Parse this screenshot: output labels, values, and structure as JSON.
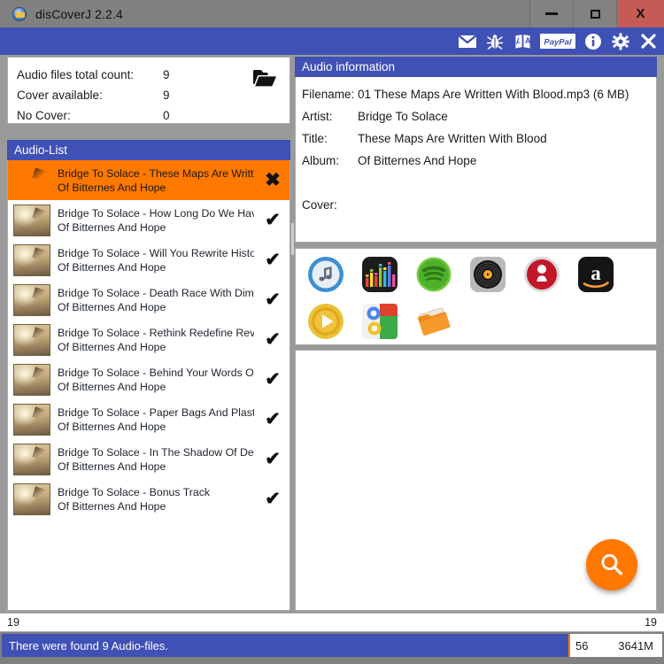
{
  "window": {
    "title": "disCoverJ 2.2.4",
    "app_icon": "disc-icon",
    "minimize_label": "",
    "maximize_label": "",
    "close_label": "X"
  },
  "toolbar": {
    "items": [
      {
        "name": "mail-icon",
        "tooltip": "Mail"
      },
      {
        "name": "bug-icon",
        "tooltip": "Report bug"
      },
      {
        "name": "translate-icon",
        "tooltip": "Translate"
      },
      {
        "name": "paypal-icon",
        "tooltip": "PayPal",
        "label": "PayPal"
      },
      {
        "name": "info-icon",
        "tooltip": "Info"
      },
      {
        "name": "gear-icon",
        "tooltip": "Settings"
      },
      {
        "name": "close-icon",
        "tooltip": "Close"
      }
    ]
  },
  "stats": {
    "rows": [
      {
        "label": "Audio files total count:",
        "value": "9"
      },
      {
        "label": "Cover available:",
        "value": "9"
      },
      {
        "label": "No Cover:",
        "value": "0"
      }
    ],
    "open_folder_icon": "open-folder-icon"
  },
  "audio_list": {
    "header": "Audio-List",
    "items": [
      {
        "title": "Bridge To Solace - These Maps Are Writte...",
        "subtitle": "Of Bitternes And Hope",
        "mark": "✖",
        "selected": true,
        "thumb": false
      },
      {
        "title": "Bridge To Solace - How Long Do We Have ...",
        "subtitle": "Of Bitternes And Hope",
        "mark": "✔",
        "selected": false,
        "thumb": true
      },
      {
        "title": "Bridge To Solace - Will You Rewrite Histor...",
        "subtitle": "Of Bitternes And Hope",
        "mark": "✔",
        "selected": false,
        "thumb": true
      },
      {
        "title": "Bridge To Solace - Death Race With Dimen...",
        "subtitle": "Of Bitternes And Hope",
        "mark": "✔",
        "selected": false,
        "thumb": true
      },
      {
        "title": "Bridge To Solace - Rethink Redefine Revolt",
        "subtitle": "Of Bitternes And Hope",
        "mark": "✔",
        "selected": false,
        "thumb": true
      },
      {
        "title": "Bridge To Solace - Behind Your Words Of ...",
        "subtitle": "Of Bitternes And Hope",
        "mark": "✔",
        "selected": false,
        "thumb": true
      },
      {
        "title": "Bridge To Solace - Paper Bags And Plastic ...",
        "subtitle": "Of Bitternes And Hope",
        "mark": "✔",
        "selected": false,
        "thumb": true
      },
      {
        "title": "Bridge To Solace - In The Shadow Of Death",
        "subtitle": "Of Bitternes And Hope",
        "mark": "✔",
        "selected": false,
        "thumb": true
      },
      {
        "title": "Bridge To Solace - Bonus Track",
        "subtitle": "Of Bitternes And Hope",
        "mark": "✔",
        "selected": false,
        "thumb": true
      }
    ]
  },
  "audio_information": {
    "header": "Audio information",
    "fields": [
      {
        "label": "Filename:",
        "value": "01 These Maps Are Written With Blood.mp3 (6 MB)"
      },
      {
        "label": "Artist:",
        "value": "Bridge To Solace"
      },
      {
        "label": "Title:",
        "value": "These Maps Are Written With Blood"
      },
      {
        "label": "Album:",
        "value": "Of Bitternes And Hope"
      }
    ],
    "cover_label": "Cover:",
    "cover_value": ""
  },
  "services": {
    "items": [
      {
        "name": "itunes-icon",
        "label": "iTunes"
      },
      {
        "name": "deezer-icon",
        "label": "Deezer"
      },
      {
        "name": "spotify-icon",
        "label": "Spotify"
      },
      {
        "name": "discogs-icon",
        "label": "Discogs"
      },
      {
        "name": "gracenote-icon",
        "label": "Gracenote"
      },
      {
        "name": "amazon-icon",
        "label": "Amazon"
      },
      {
        "name": "bing-icon",
        "label": "Bing"
      },
      {
        "name": "google-icon",
        "label": "Google Images"
      },
      {
        "name": "local-folder-icon",
        "label": "Local folder"
      }
    ]
  },
  "results": {
    "search_button_icon": "search-icon",
    "empty_text": ""
  },
  "count_bar": {
    "left": "19",
    "right": "19"
  },
  "status_bar": {
    "message": "There were found 9 Audio-files.",
    "progress_percent": 86,
    "value_1": "56",
    "value_2": "3641M"
  },
  "colors": {
    "accent_blue": "#3F51B5",
    "accent_orange": "#FF7800",
    "window_chrome": "#808080",
    "close_button": "#C45B55",
    "panel_bg": "#FFFFFF"
  }
}
